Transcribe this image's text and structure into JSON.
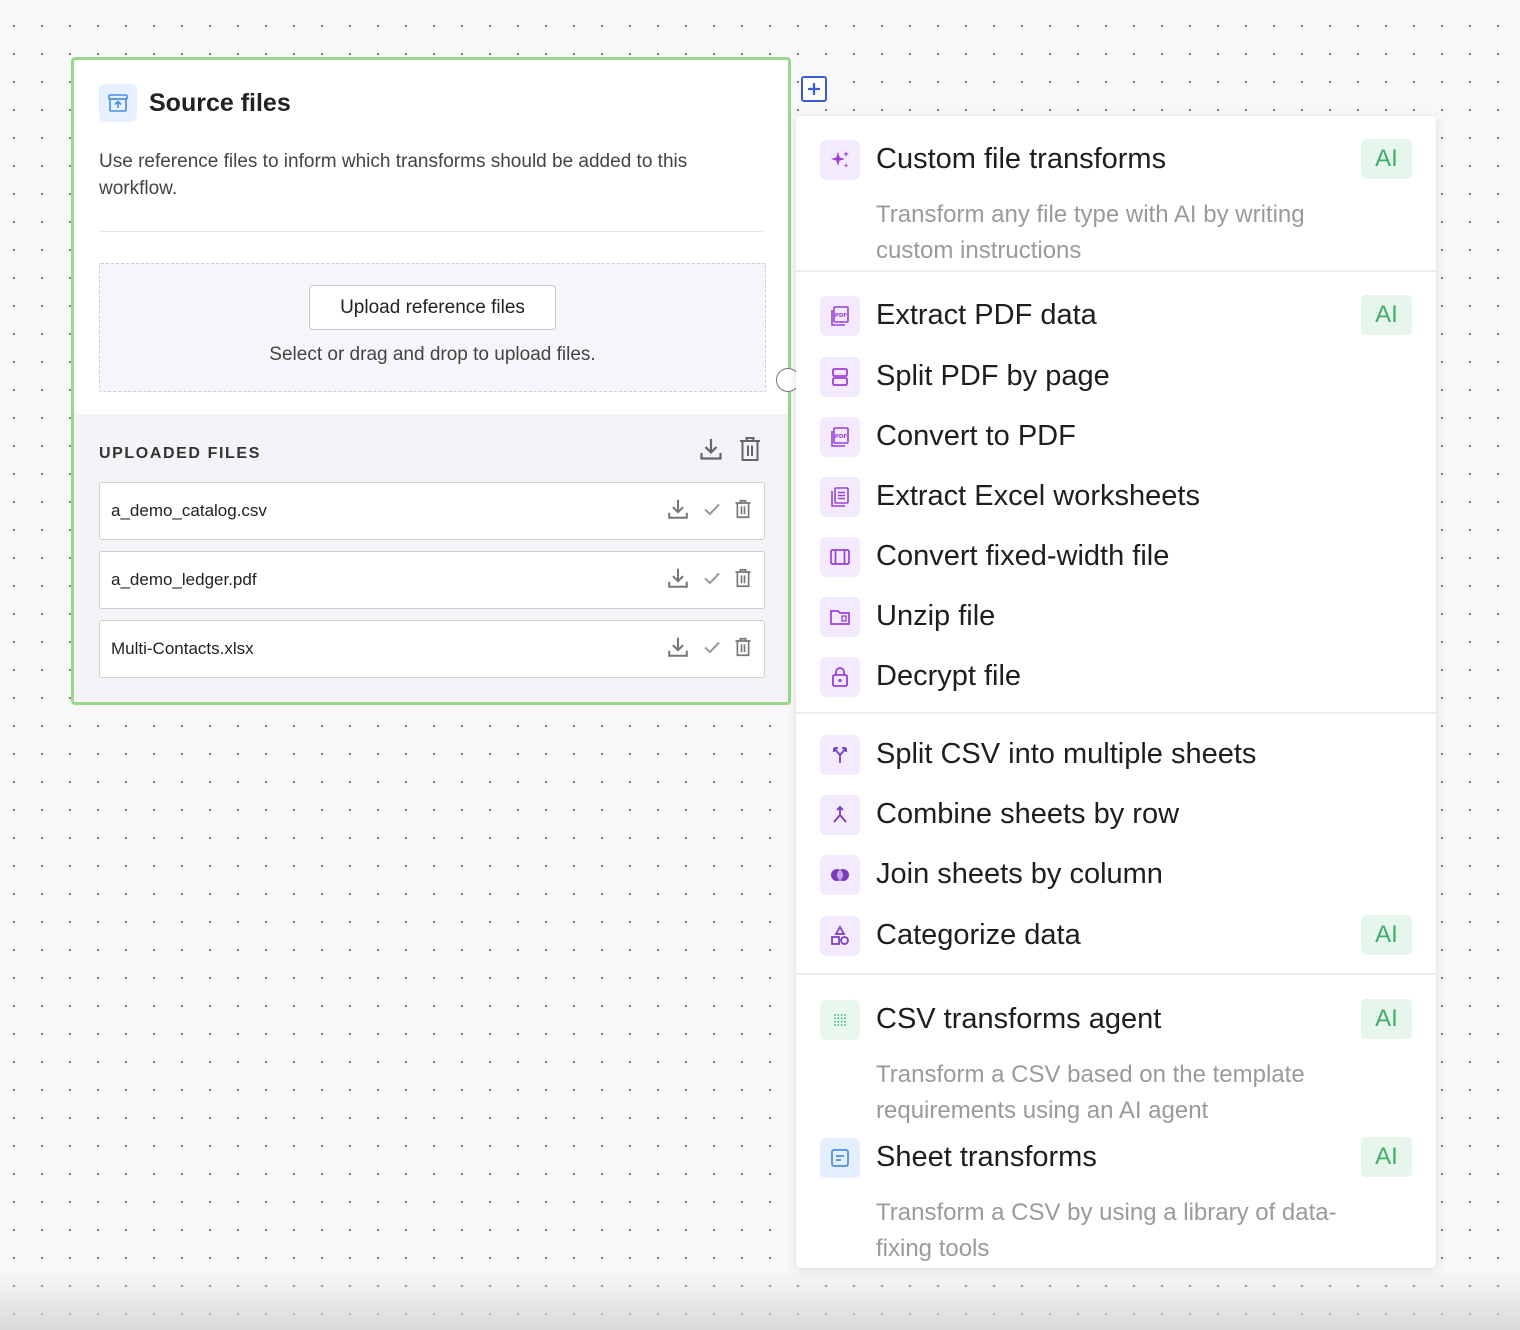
{
  "source_card": {
    "title": "Source files",
    "description": "Use reference files to inform which transforms should be added to this workflow.",
    "upload_button": "Upload reference files",
    "drop_hint": "Select or drag and drop to upload files.",
    "uploaded_title": "UPLOADED FILES",
    "files": [
      {
        "name": "a_demo_catalog.csv"
      },
      {
        "name": "a_demo_ledger.pdf"
      },
      {
        "name": "Multi-Contacts.xlsx"
      }
    ]
  },
  "menu": {
    "items": [
      {
        "label": "Custom file transforms",
        "description": "Transform any file type with AI by writing custom instructions",
        "badge": "AI",
        "icon": "sparkles-icon"
      },
      {
        "label": "Extract PDF data",
        "badge": "AI",
        "icon": "pdf-icon"
      },
      {
        "label": "Split PDF by page",
        "icon": "split-page-icon"
      },
      {
        "label": "Convert to PDF",
        "icon": "pdf-icon"
      },
      {
        "label": "Extract Excel worksheets",
        "icon": "worksheets-icon"
      },
      {
        "label": "Convert fixed-width file",
        "icon": "fixed-width-icon"
      },
      {
        "label": "Unzip file",
        "icon": "zip-folder-icon"
      },
      {
        "label": "Decrypt file",
        "icon": "lock-icon"
      },
      {
        "label": "Split CSV into multiple sheets",
        "icon": "split-arrows-icon"
      },
      {
        "label": "Combine sheets by row",
        "icon": "merge-arrows-icon"
      },
      {
        "label": "Join sheets by column",
        "icon": "venn-icon"
      },
      {
        "label": "Categorize data",
        "badge": "AI",
        "icon": "shapes-icon"
      },
      {
        "label": "CSV transforms agent",
        "description": "Transform a CSV based on the template requirements using an AI agent",
        "badge": "AI",
        "icon": "grid-dots-icon"
      },
      {
        "label": "Sheet transforms",
        "description": "Transform a CSV by using a library of data-fixing tools",
        "badge": "AI",
        "icon": "sheet-icon"
      }
    ]
  },
  "colors": {
    "card_border": "#9ad68c",
    "accent_purple": "#9b3fd6",
    "ai_badge_text": "#3fae6a",
    "ai_badge_bg": "#e6f6ec",
    "add_button": "#3b5bdb"
  }
}
